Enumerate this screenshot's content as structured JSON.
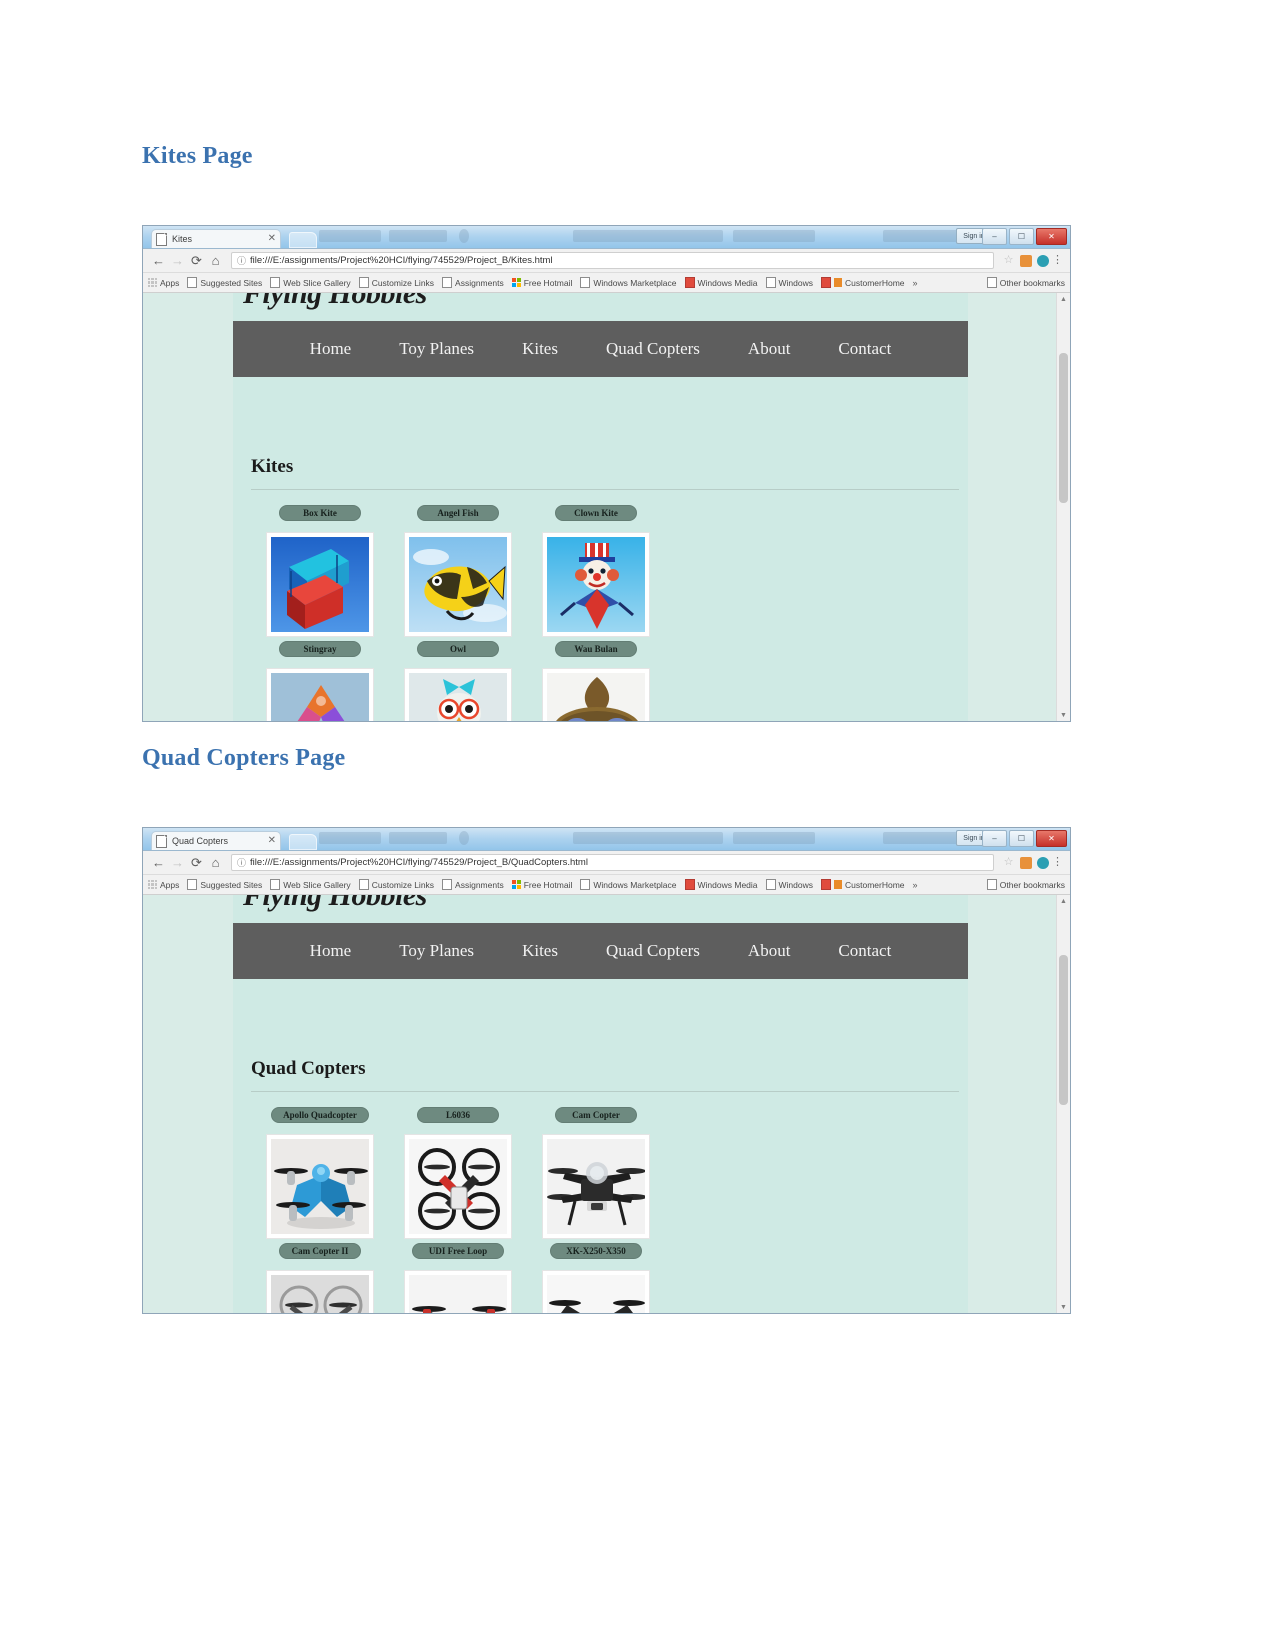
{
  "document": {
    "headings": [
      {
        "id": "kites",
        "text": "Kites Page"
      },
      {
        "id": "quad",
        "text": "Quad Copters Page"
      }
    ]
  },
  "browser_chrome": {
    "window_buttons": {
      "minimize": "–",
      "maximize": "☐",
      "close": "✕"
    },
    "signin_label": "Sign in",
    "nav": {
      "back": "←",
      "forward": "→",
      "reload": "⟳",
      "home": "⌂"
    },
    "omnibox_info_icon": "ⓘ",
    "toolbar_icons": {
      "bookmark_star": "☆",
      "extension_orange": "#e8913a",
      "extension_teal": "#2b9fb3",
      "menu": "⋮"
    },
    "bookmarks": [
      {
        "label": "Apps",
        "icon": "apps-grid-icon"
      },
      {
        "label": "Suggested Sites",
        "icon": "page-icon"
      },
      {
        "label": "Web Slice Gallery",
        "icon": "page-icon"
      },
      {
        "label": "Customize Links",
        "icon": "page-icon"
      },
      {
        "label": "Assignments",
        "icon": "page-icon"
      },
      {
        "label": "Free Hotmail",
        "icon": "microsoft-icon"
      },
      {
        "label": "Windows Marketplace",
        "icon": "page-icon"
      },
      {
        "label": "Windows Media",
        "icon": "media-icon"
      },
      {
        "label": "Windows",
        "icon": "page-icon"
      },
      {
        "label": "CustomerHome",
        "icon": "customer-icon"
      }
    ],
    "bookmarks_overflow": "»",
    "other_bookmarks": "Other bookmarks"
  },
  "site": {
    "logo": "Flying Hobbies",
    "nav_items": [
      "Home",
      "Toy Planes",
      "Kites",
      "Quad Copters",
      "About",
      "Contact"
    ]
  },
  "screens": [
    {
      "id": "kites",
      "tab_title": "Kites",
      "tab_close": "✕",
      "url": "file:///E:/assignments/Project%20HCI/flying/745529/Project_B/Kites.html",
      "section_title": "Kites",
      "items": [
        {
          "label": "Box Kite",
          "art": "box-kite"
        },
        {
          "label": "Angel Fish",
          "art": "angel-fish"
        },
        {
          "label": "Clown Kite",
          "art": "clown-kite"
        },
        {
          "label": "Stingray",
          "art": "stingray"
        },
        {
          "label": "Owl",
          "art": "owl"
        },
        {
          "label": "Wau Bulan",
          "art": "wau-bulan"
        }
      ]
    },
    {
      "id": "quad",
      "tab_title": "Quad Copters",
      "tab_close": "✕",
      "url": "file:///E:/assignments/Project%20HCI/flying/745529/Project_B/QuadCopters.html",
      "section_title": "Quad Copters",
      "items": [
        {
          "label": "Apollo Quadcopter",
          "art": "apollo"
        },
        {
          "label": "L6036",
          "art": "l6036"
        },
        {
          "label": "Cam Copter",
          "art": "camcopter"
        },
        {
          "label": "Cam Copter II",
          "art": "camcopter2"
        },
        {
          "label": "UDI Free Loop",
          "art": "udi"
        },
        {
          "label": "XK-X250-X350",
          "art": "xk"
        }
      ]
    }
  ],
  "colors": {
    "heading": "#3b72af",
    "page_bg": "#cfeae4",
    "navbar": "#5e5e5e",
    "pill": "#6e8a80"
  },
  "scrollbar": {
    "up": "▲",
    "down": "▼"
  }
}
